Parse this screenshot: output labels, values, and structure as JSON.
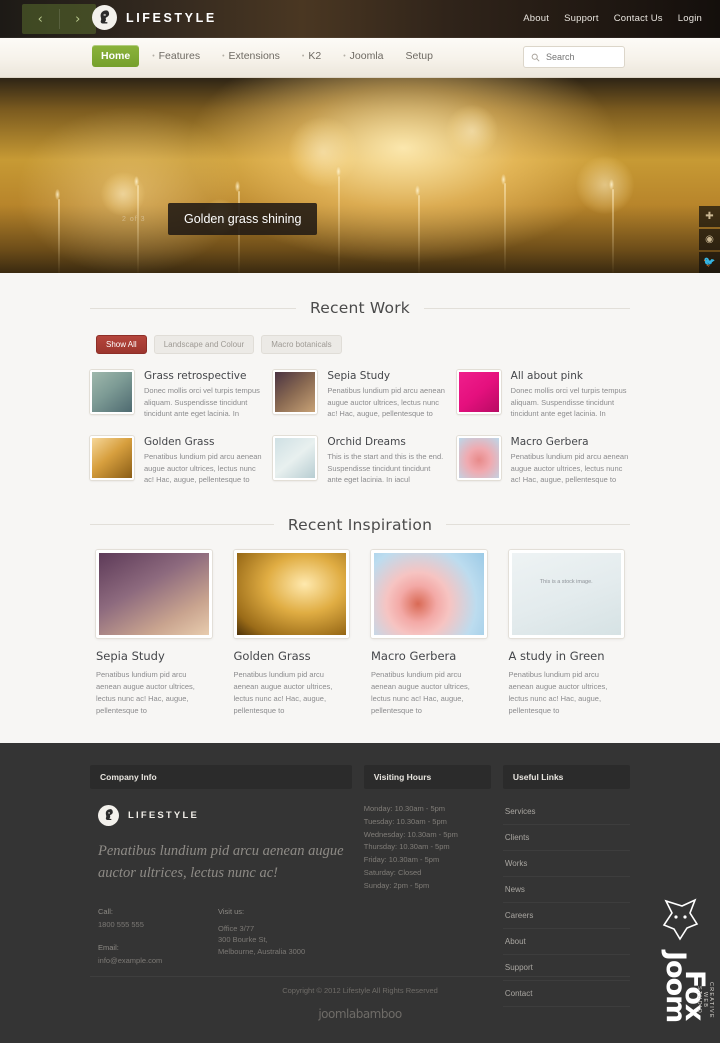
{
  "topbar": {
    "brand_name": "LIFESTYLE",
    "prev_arrow": "‹",
    "next_arrow": "›",
    "nav": [
      {
        "label": "About"
      },
      {
        "label": "Support"
      },
      {
        "label": "Contact Us"
      },
      {
        "label": "Login"
      }
    ]
  },
  "mainnav": {
    "items": [
      {
        "label": "Home",
        "active": true,
        "caret": ""
      },
      {
        "label": "Features",
        "active": false,
        "caret": "•"
      },
      {
        "label": "Extensions",
        "active": false,
        "caret": "•"
      },
      {
        "label": "K2",
        "active": false,
        "caret": "•"
      },
      {
        "label": "Joomla",
        "active": false,
        "caret": "•"
      },
      {
        "label": "Setup",
        "active": false,
        "caret": ""
      }
    ],
    "search_placeholder": "Search",
    "search_value": ""
  },
  "hero": {
    "caption": "Golden grass shining",
    "counter": "2 of 3",
    "social": [
      {
        "name": "plus-icon",
        "glyph": "✚"
      },
      {
        "name": "flickr-icon",
        "glyph": "◉"
      },
      {
        "name": "twitter-icon",
        "glyph": "🐦"
      },
      {
        "name": "heart-icon",
        "glyph": "♥"
      }
    ]
  },
  "recent_work": {
    "title": "Recent Work",
    "filters": [
      {
        "label": "Show All",
        "active": true
      },
      {
        "label": "Landscape and Colour",
        "active": false
      },
      {
        "label": "Macro botanicals",
        "active": false
      }
    ],
    "items": [
      {
        "title": "Grass retrospective",
        "excerpt": "Donec mollis orci vel turpis tempus aliquam. Suspendisse tincidunt tincidunt ante eget lacinia. In",
        "thumb": "grass"
      },
      {
        "title": "Sepia Study",
        "excerpt": "Penatibus lundium pid arcu aenean augue auctor ultrices, lectus nunc ac! Hac, augue, pellentesque to",
        "thumb": "sepia"
      },
      {
        "title": "All about pink",
        "excerpt": "Donec mollis orci vel turpis tempus aliquam. Suspendisse tincidunt tincidunt ante eget lacinia. In",
        "thumb": "pink"
      },
      {
        "title": "Golden Grass",
        "excerpt": "Penatibus lundium pid arcu aenean augue auctor ultrices, lectus nunc ac! Hac, augue, pellentesque to",
        "thumb": "golden"
      },
      {
        "title": "Orchid Dreams",
        "excerpt": "This is the start and this is the end. Suspendisse tincidunt tincidunt ante eget lacinia. In iacul",
        "thumb": "orchid"
      },
      {
        "title": "Macro Gerbera",
        "excerpt": "Penatibus lundium pid arcu aenean augue auctor ultrices, lectus nunc ac! Hac, augue, pellentesque to",
        "thumb": "gerbera"
      }
    ]
  },
  "recent_inspiration": {
    "title": "Recent Inspiration",
    "items": [
      {
        "title": "Sepia Study",
        "excerpt": "Penatibus lundium pid arcu aenean augue auctor ultrices, lectus nunc ac! Hac, augue, pellentesque to",
        "image": "sepia",
        "note": ""
      },
      {
        "title": "Golden Grass",
        "excerpt": "Penatibus lundium pid arcu aenean augue auctor ultrices, lectus nunc ac! Hac, augue, pellentesque to",
        "image": "golden",
        "note": ""
      },
      {
        "title": "Macro Gerbera",
        "excerpt": "Penatibus lundium pid arcu aenean augue auctor ultrices, lectus nunc ac! Hac, augue, pellentesque to",
        "image": "gerbera",
        "note": ""
      },
      {
        "title": "A study in Green",
        "excerpt": "Penatibus lundium pid arcu aenean augue auctor ultrices, lectus nunc ac! Hac, augue, pellentesque to",
        "image": "green",
        "note": "This is a stock image."
      }
    ]
  },
  "footer": {
    "company": {
      "heading": "Company Info",
      "brand_name": "LIFESTYLE",
      "tagline": "Penatibus lundium pid arcu aenean augue auctor ultrices, lectus nunc ac!",
      "call_label": "Call:",
      "call_value": "1800 555 555",
      "email_label": "Email:",
      "email_value": "info@example.com",
      "visit_label": "Visit us:",
      "visit_value": "Office 3/77\n300 Bourke St,\nMelbourne, Australia 3000"
    },
    "hours": {
      "heading": "Visiting Hours",
      "rows": [
        "Monday: 10.30am - 5pm",
        "Tuesday: 10.30am - 5pm",
        "Wednesday: 10.30am - 5pm",
        "Thursday: 10.30am - 5pm",
        "Friday: 10.30am - 5pm",
        "Saturday: Closed",
        "Sunday: 2pm - 5pm"
      ]
    },
    "links": {
      "heading": "Useful Links",
      "items": [
        {
          "label": "Services"
        },
        {
          "label": "Clients"
        },
        {
          "label": "Works"
        },
        {
          "label": "News"
        },
        {
          "label": "Careers"
        },
        {
          "label": "About"
        },
        {
          "label": "Support"
        },
        {
          "label": "Contact"
        }
      ]
    },
    "copyright": "Copyright © 2012 Lifestyle  All Rights Reserved",
    "vendor_logo": "joomlabamboo",
    "watermark": {
      "line1": "Joom",
      "line2": "Fox",
      "sub": "CREATIVE WEB STUDIO"
    }
  },
  "colors": {
    "accent_green": "#7ba52f",
    "accent_red": "#a8392f",
    "footer_bg": "#343434",
    "page_bg": "#f7f6f4"
  }
}
